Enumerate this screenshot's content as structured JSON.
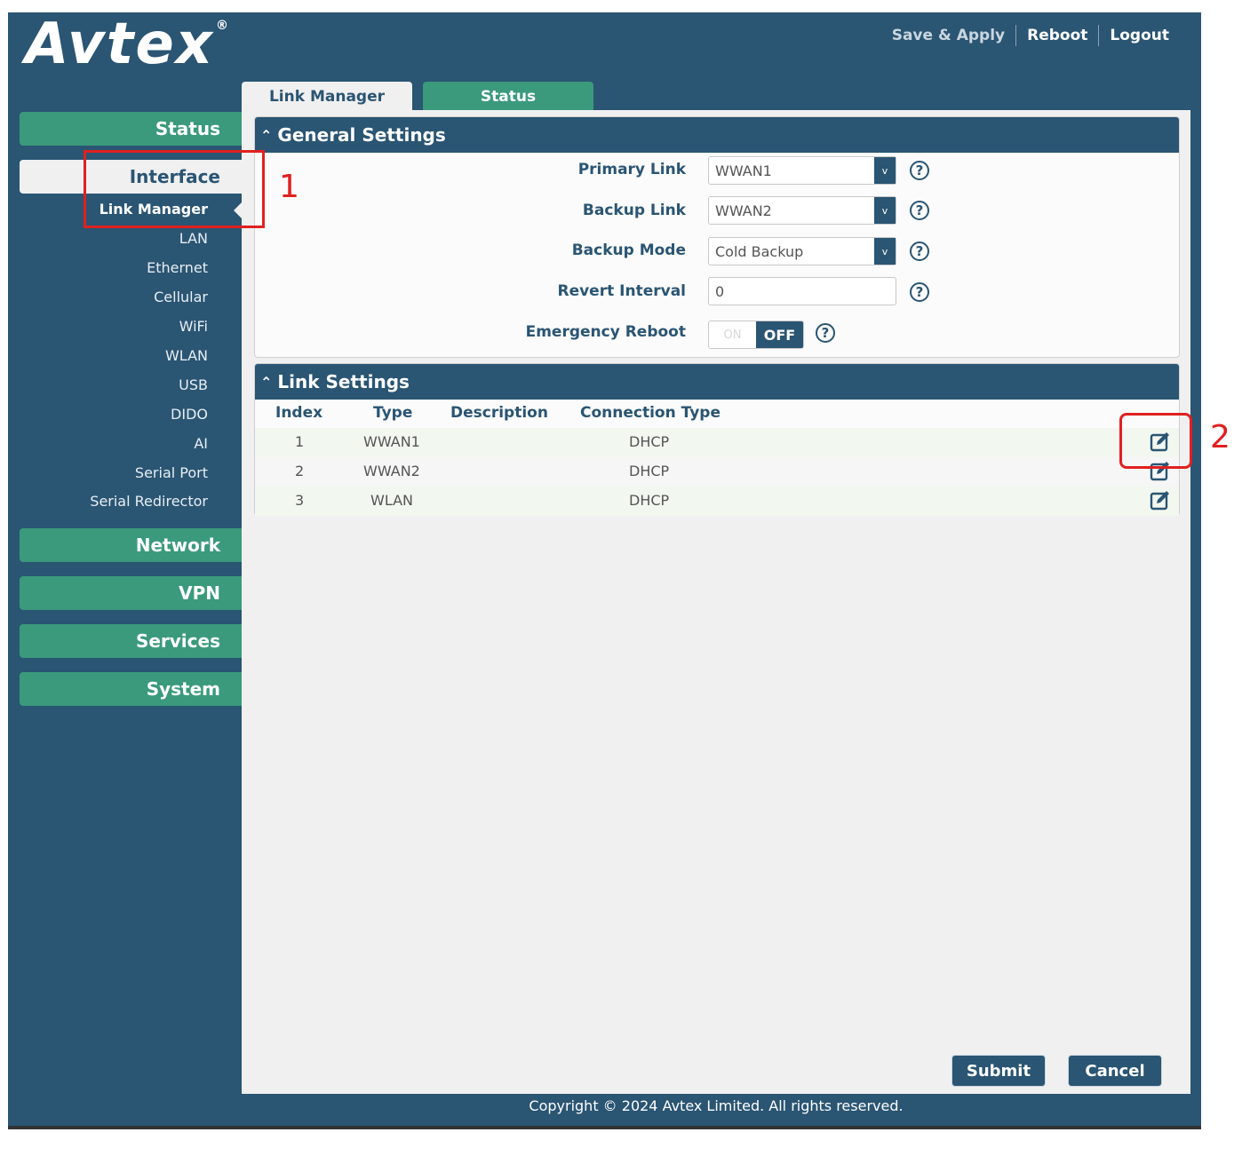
{
  "brand": {
    "logo": "Avtex"
  },
  "header": {
    "links": [
      "Save & Apply",
      "Reboot",
      "Logout"
    ]
  },
  "tabs": [
    "Link Manager",
    "Status"
  ],
  "sidebar": {
    "sections": [
      "Status",
      "Interface",
      "Network",
      "VPN",
      "Services",
      "System"
    ],
    "interface_items": [
      "Link Manager",
      "LAN",
      "Ethernet",
      "Cellular",
      "WiFi",
      "WLAN",
      "USB",
      "DIDO",
      "AI",
      "Serial Port",
      "Serial Redirector"
    ]
  },
  "general": {
    "title": "General Settings",
    "primary_link": {
      "label": "Primary Link",
      "value": "WWAN1"
    },
    "backup_link": {
      "label": "Backup Link",
      "value": "WWAN2"
    },
    "backup_mode": {
      "label": "Backup Mode",
      "value": "Cold Backup"
    },
    "revert_interval": {
      "label": "Revert Interval",
      "value": "0"
    },
    "emergency_reboot": {
      "label": "Emergency Reboot",
      "on": "ON",
      "off": "OFF"
    }
  },
  "link_settings": {
    "title": "Link Settings",
    "headers": [
      "Index",
      "Type",
      "Description",
      "Connection Type"
    ],
    "rows": [
      {
        "index": "1",
        "type": "WWAN1",
        "description": "",
        "connection": "DHCP"
      },
      {
        "index": "2",
        "type": "WWAN2",
        "description": "",
        "connection": "DHCP"
      },
      {
        "index": "3",
        "type": "WLAN",
        "description": "",
        "connection": "DHCP"
      }
    ]
  },
  "actions": {
    "submit": "Submit",
    "cancel": "Cancel"
  },
  "footer": {
    "copyright": "Copyright © 2024 Avtex Limited. All rights reserved."
  },
  "annotations": [
    "1",
    "2"
  ],
  "colors": {
    "navy": "#2a5573",
    "green": "#3b9a7b",
    "annotation": "#e02020"
  },
  "icons": {
    "help": "help-circle-icon",
    "edit": "edit-icon",
    "dropdown": "chevron-down-icon",
    "collapse": "chevron-up-icon"
  }
}
